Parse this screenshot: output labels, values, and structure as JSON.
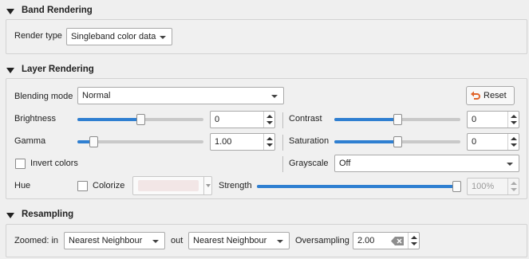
{
  "band_rendering": {
    "title": "Band Rendering",
    "render_type_label": "Render type",
    "render_type_value": "Singleband color data"
  },
  "layer_rendering": {
    "title": "Layer Rendering",
    "blending_mode_label": "Blending mode",
    "blending_mode_value": "Normal",
    "reset_label": "Reset",
    "brightness_label": "Brightness",
    "brightness_value": "0",
    "brightness_level": 0.5,
    "contrast_label": "Contrast",
    "contrast_value": "0",
    "contrast_level": 0.5,
    "gamma_label": "Gamma",
    "gamma_value": "1.00",
    "gamma_level": 0.1,
    "saturation_label": "Saturation",
    "saturation_value": "0",
    "saturation_level": 0.5,
    "invert_colors_label": "Invert colors",
    "invert_colors_checked": false,
    "grayscale_label": "Grayscale",
    "grayscale_value": "Off",
    "hue_label": "Hue",
    "colorize_label": "Colorize",
    "colorize_checked": false,
    "strength_label": "Strength",
    "strength_value": "100%",
    "strength_level": 1.0,
    "colors": {
      "slider_fill": "#2f7fd1",
      "reset_icon": "#e0642a",
      "colorize_swatch": "#f2e6e6"
    }
  },
  "resampling": {
    "title": "Resampling",
    "zoomed_in_label": "Zoomed: in",
    "zoomed_in_value": "Nearest Neighbour",
    "zoomed_out_label": "out",
    "zoomed_out_value": "Nearest Neighbour",
    "oversampling_label": "Oversampling",
    "oversampling_value": "2.00"
  },
  "icons": [
    "collapse-triangle-icon",
    "reset-undo-icon",
    "clear-backspace-icon",
    "chevron-down-icon",
    "spin-up-icon",
    "spin-down-icon"
  ]
}
